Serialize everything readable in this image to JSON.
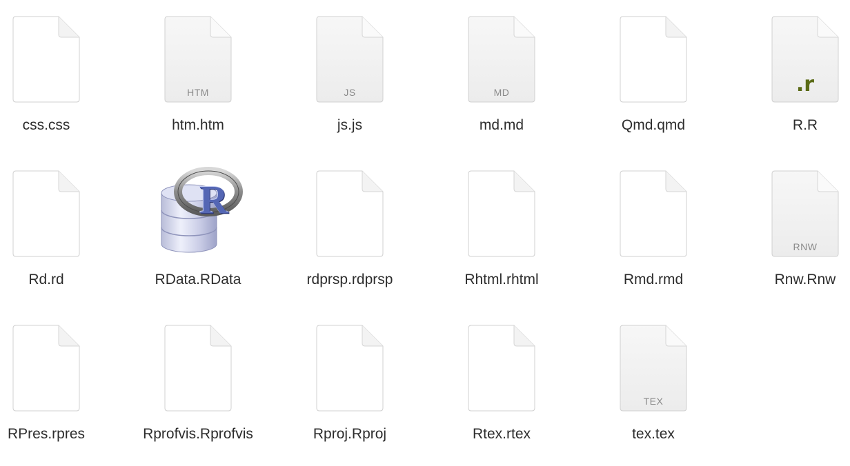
{
  "files": [
    {
      "name": "css.css",
      "badge": ""
    },
    {
      "name": "htm.htm",
      "badge": "HTM"
    },
    {
      "name": "js.js",
      "badge": "JS"
    },
    {
      "name": "md.md",
      "badge": "MD"
    },
    {
      "name": "Qmd.qmd",
      "badge": ""
    },
    {
      "name": "R.R",
      "badge": ".r"
    },
    {
      "name": "Rd.rd",
      "badge": ""
    },
    {
      "name": "RData.RData",
      "badge": "",
      "icon": "rdata-database-icon",
      "icon_letter": "R"
    },
    {
      "name": "rdprsp.rdprsp",
      "badge": ""
    },
    {
      "name": "Rhtml.rhtml",
      "badge": ""
    },
    {
      "name": "Rmd.rmd",
      "badge": ""
    },
    {
      "name": "Rnw.Rnw",
      "badge": "RNW"
    },
    {
      "name": "RPres.rpres",
      "badge": ""
    },
    {
      "name": "Rprofvis.Rprofvis",
      "badge": ""
    },
    {
      "name": "Rproj.Rproj",
      "badge": ""
    },
    {
      "name": "Rtex.rtex",
      "badge": ""
    },
    {
      "name": "tex.tex",
      "badge": "TEX"
    }
  ],
  "colors": {
    "label": "#2d2d2d",
    "badge": "#8a8a8a",
    "r_badge": "#5b6b17",
    "blank_doc": "#ffffff",
    "grey_doc": "#f1f1f1"
  }
}
